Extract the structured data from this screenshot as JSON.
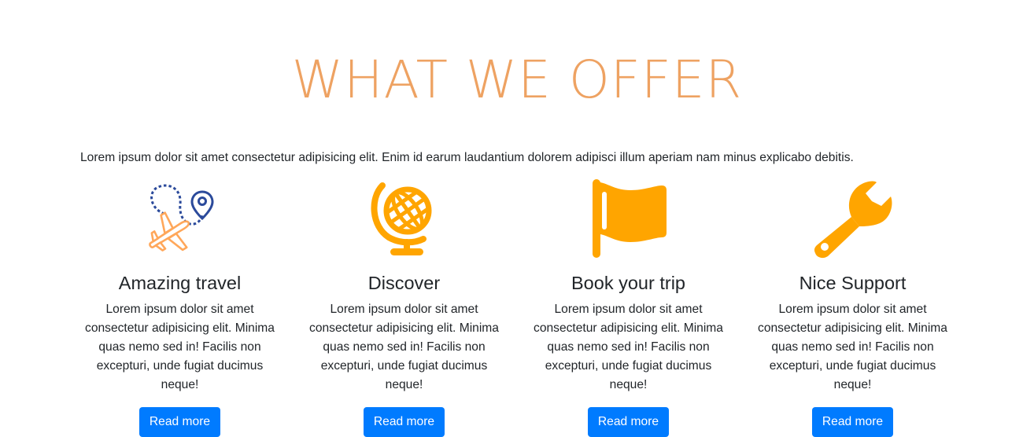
{
  "section": {
    "title": "WHAT WE OFFER",
    "intro": "Lorem ipsum dolor sit amet consectetur adipisicing elit. Enim id earum laudantium dolorem adipisci illum aperiam nam minus explicabo debitis."
  },
  "colors": {
    "title": "#eea262",
    "icon_orange": "#ffa500",
    "icon_blue": "#2b4a9b",
    "button": "#007bff"
  },
  "cards": [
    {
      "icon": "airplane-route-icon",
      "title": "Amazing travel",
      "text": "Lorem ipsum dolor sit amet consectetur adipisicing elit. Minima quas nemo sed in! Facilis non excepturi, unde fugiat ducimus neque!",
      "button_label": "Read more"
    },
    {
      "icon": "globe-icon",
      "title": "Discover",
      "text": "Lorem ipsum dolor sit amet consectetur adipisicing elit. Minima quas nemo sed in! Facilis non excepturi, unde fugiat ducimus neque!",
      "button_label": "Read more"
    },
    {
      "icon": "flag-icon",
      "title": "Book your trip",
      "text": "Lorem ipsum dolor sit amet consectetur adipisicing elit. Minima quas nemo sed in! Facilis non excepturi, unde fugiat ducimus neque!",
      "button_label": "Read more"
    },
    {
      "icon": "wrench-icon",
      "title": "Nice Support",
      "text": "Lorem ipsum dolor sit amet consectetur adipisicing elit. Minima quas nemo sed in! Facilis non excepturi, unde fugiat ducimus neque!",
      "button_label": "Read more"
    }
  ]
}
